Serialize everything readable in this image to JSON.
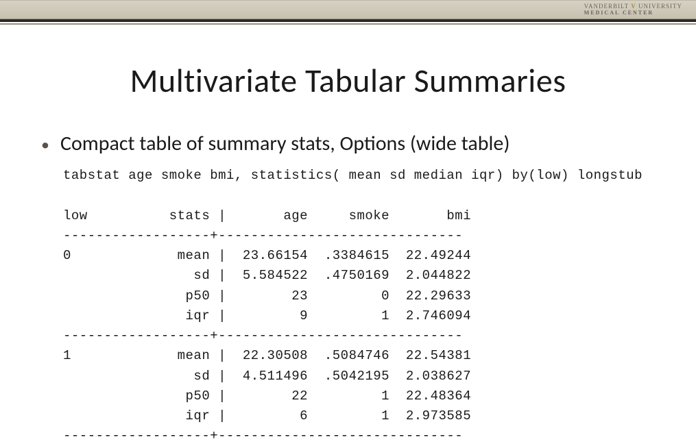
{
  "logo": {
    "brand_a": "VANDERBILT",
    "brand_v": "V",
    "brand_b": "UNIVERSITY",
    "sub": "MEDICAL CENTER"
  },
  "title": "Multivariate Tabular Summaries",
  "bullet": "Compact table of summary stats, Options (wide table)",
  "command": "tabstat age smoke bmi, statistics( mean sd median iqr) by(low) longstub",
  "table": {
    "group_col": "low",
    "stat_col": "stats",
    "vars": [
      "age",
      "smoke",
      "bmi"
    ],
    "groups": [
      {
        "name": "0",
        "rows": [
          {
            "stat": "mean",
            "vals": [
              "23.66154",
              ".3384615",
              "22.49244"
            ]
          },
          {
            "stat": "sd",
            "vals": [
              "5.584522",
              ".4750169",
              "2.044822"
            ]
          },
          {
            "stat": "p50",
            "vals": [
              "23",
              "0",
              "22.29633"
            ]
          },
          {
            "stat": "iqr",
            "vals": [
              "9",
              "1",
              "2.746094"
            ]
          }
        ]
      },
      {
        "name": "1",
        "rows": [
          {
            "stat": "mean",
            "vals": [
              "22.30508",
              ".5084746",
              "22.54381"
            ]
          },
          {
            "stat": "sd",
            "vals": [
              "4.511496",
              ".5042195",
              "2.038627"
            ]
          },
          {
            "stat": "p50",
            "vals": [
              "22",
              "1",
              "22.48364"
            ]
          },
          {
            "stat": "iqr",
            "vals": [
              "6",
              "1",
              "2.973585"
            ]
          }
        ]
      }
    ]
  },
  "chart_data": {
    "type": "table",
    "title": "Multivariate Tabular Summaries",
    "by": "low",
    "statistics": [
      "mean",
      "sd",
      "p50",
      "iqr"
    ],
    "variables": [
      "age",
      "smoke",
      "bmi"
    ],
    "data": {
      "0": {
        "age": {
          "mean": 23.66154,
          "sd": 5.584522,
          "p50": 23,
          "iqr": 9
        },
        "smoke": {
          "mean": 0.3384615,
          "sd": 0.4750169,
          "p50": 0,
          "iqr": 1
        },
        "bmi": {
          "mean": 22.49244,
          "sd": 2.044822,
          "p50": 22.29633,
          "iqr": 2.746094
        }
      },
      "1": {
        "age": {
          "mean": 22.30508,
          "sd": 4.511496,
          "p50": 22,
          "iqr": 6
        },
        "smoke": {
          "mean": 0.5084746,
          "sd": 0.5042195,
          "p50": 1,
          "iqr": 1
        },
        "bmi": {
          "mean": 22.54381,
          "sd": 2.038627,
          "p50": 22.48364,
          "iqr": 2.973585
        }
      }
    }
  }
}
